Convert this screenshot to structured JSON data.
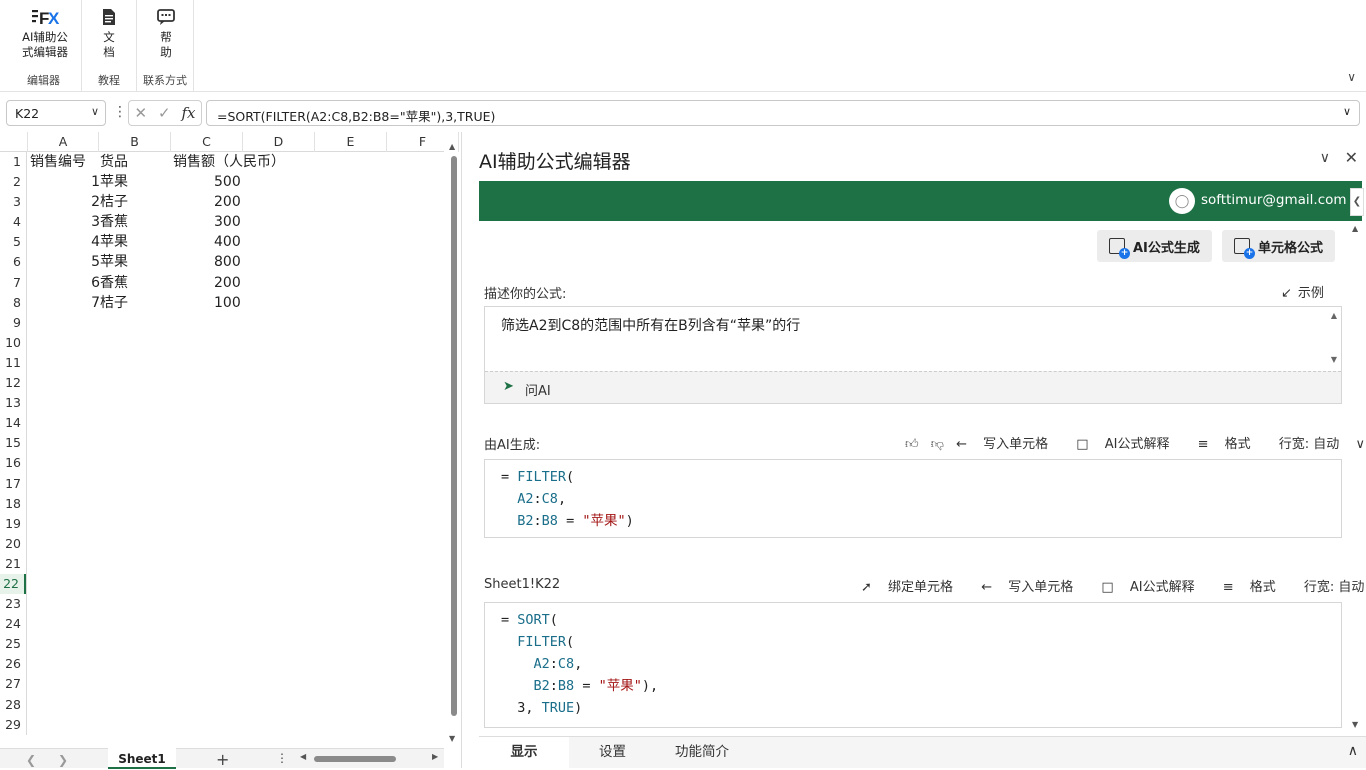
{
  "ribbon": {
    "buttons": [
      {
        "label1": "AI辅助公",
        "label2": "式编辑器",
        "icon": "fx-logo-icon"
      },
      {
        "label1": "文",
        "label2": "档",
        "icon": "document-icon"
      },
      {
        "label1": "帮",
        "label2": "助",
        "icon": "chat-help-icon"
      }
    ],
    "groups": [
      "编辑器",
      "教程",
      "联系方式"
    ]
  },
  "formula_bar": {
    "name_box": "K22",
    "formula": "=SORT(FILTER(A2:C8,B2:B8=\"苹果\"),3,TRUE)",
    "fx": "fx"
  },
  "sheet": {
    "columns": [
      "A",
      "B",
      "C",
      "D",
      "E",
      "F"
    ],
    "rows": [
      "1",
      "2",
      "3",
      "4",
      "5",
      "6",
      "7",
      "8",
      "9",
      "10",
      "11",
      "12",
      "13",
      "14",
      "15",
      "16",
      "17",
      "18",
      "19",
      "20",
      "21",
      "22",
      "23",
      "24",
      "25",
      "26",
      "27",
      "28",
      "29"
    ],
    "selected_row": "22",
    "data": [
      [
        "销售编号",
        "货品",
        "销售额（人民币）"
      ],
      [
        "1",
        "苹果",
        "500"
      ],
      [
        "2",
        "桔子",
        "200"
      ],
      [
        "3",
        "香蕉",
        "300"
      ],
      [
        "4",
        "苹果",
        "400"
      ],
      [
        "5",
        "苹果",
        "800"
      ],
      [
        "6",
        "香蕉",
        "200"
      ],
      [
        "7",
        "桔子",
        "100"
      ]
    ],
    "tab": "Sheet1",
    "add_tab": "+",
    "more": "⋮"
  },
  "pane": {
    "title": "AI辅助公式编辑器",
    "email": "softtimur@gmail.com",
    "btn_generate": "AI公式生成",
    "btn_cell": "单元格公式",
    "describe_label": "描述你的公式:",
    "example": "示例",
    "description": "筛选A2到C8的范围中所有在B列含有“苹果”的行",
    "ask": "问AI",
    "generated_label": "由AI生成:",
    "write_cell": "写入单元格",
    "explain": "AI公式解释",
    "format": "格式",
    "line_width": "行宽: 自动",
    "cell_ref": "Sheet1!K22",
    "bind_cell": "绑定单元格",
    "tabs": [
      "显示",
      "设置",
      "功能简介"
    ]
  }
}
